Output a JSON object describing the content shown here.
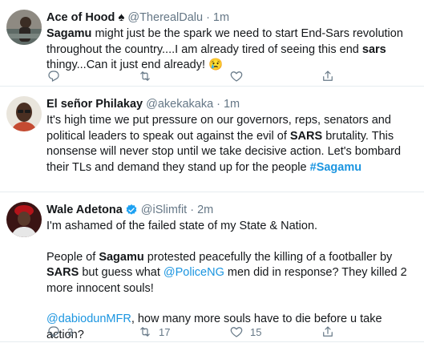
{
  "tweets": [
    {
      "name": "Ace of Hood",
      "handle": "@TherealDalu",
      "time": "1m",
      "segments": [
        {
          "t": "Sagamu",
          "s": "bold"
        },
        {
          "t": " might just be the spark we need to start End-Sars revolution throughout the country....I am already tired of seeing this end ",
          "s": ""
        },
        {
          "t": "sars",
          "s": "bold"
        },
        {
          "t": " thingy...Can it just end already! 😢",
          "s": ""
        }
      ],
      "counts": {
        "reply": "",
        "retweet": "",
        "like": ""
      }
    },
    {
      "name": "El señor Philakay",
      "handle": "@akekakaka",
      "time": "1m",
      "segments": [
        {
          "t": "It's high time we put pressure on our governors, reps, senators and political leaders to speak out against the evil of ",
          "s": ""
        },
        {
          "t": "SARS",
          "s": "bold"
        },
        {
          "t": " brutality. This nonsense will never stop until we take decisive action. Let's bombard their TLs and demand they stand up for the people ",
          "s": ""
        },
        {
          "t": "#Sagamu",
          "s": "boldlink"
        }
      ],
      "counts": {
        "reply": "",
        "retweet": "",
        "like": ""
      }
    },
    {
      "name": "Wale Adetona",
      "handle": "@iSlimfit",
      "time": "2m",
      "verified": true,
      "paragraphs": [
        [
          {
            "t": "I'm ashamed of the failed state of my State & Nation.",
            "s": ""
          }
        ],
        [
          {
            "t": "People of ",
            "s": ""
          },
          {
            "t": "Sagamu",
            "s": "bold"
          },
          {
            "t": " protested peacefully the killing of a footballer by ",
            "s": ""
          },
          {
            "t": "SARS",
            "s": "bold"
          },
          {
            "t": " but guess what ",
            "s": ""
          },
          {
            "t": "@PoliceNG",
            "s": "link"
          },
          {
            "t": " men did in response? They killed 2 more innocent souls!",
            "s": ""
          }
        ],
        [
          {
            "t": "@dabiodunMFR",
            "s": "link"
          },
          {
            "t": ", how many more souls have to die before u take action?",
            "s": ""
          }
        ]
      ],
      "counts": {
        "reply": "3",
        "retweet": "17",
        "like": "15"
      }
    }
  ]
}
